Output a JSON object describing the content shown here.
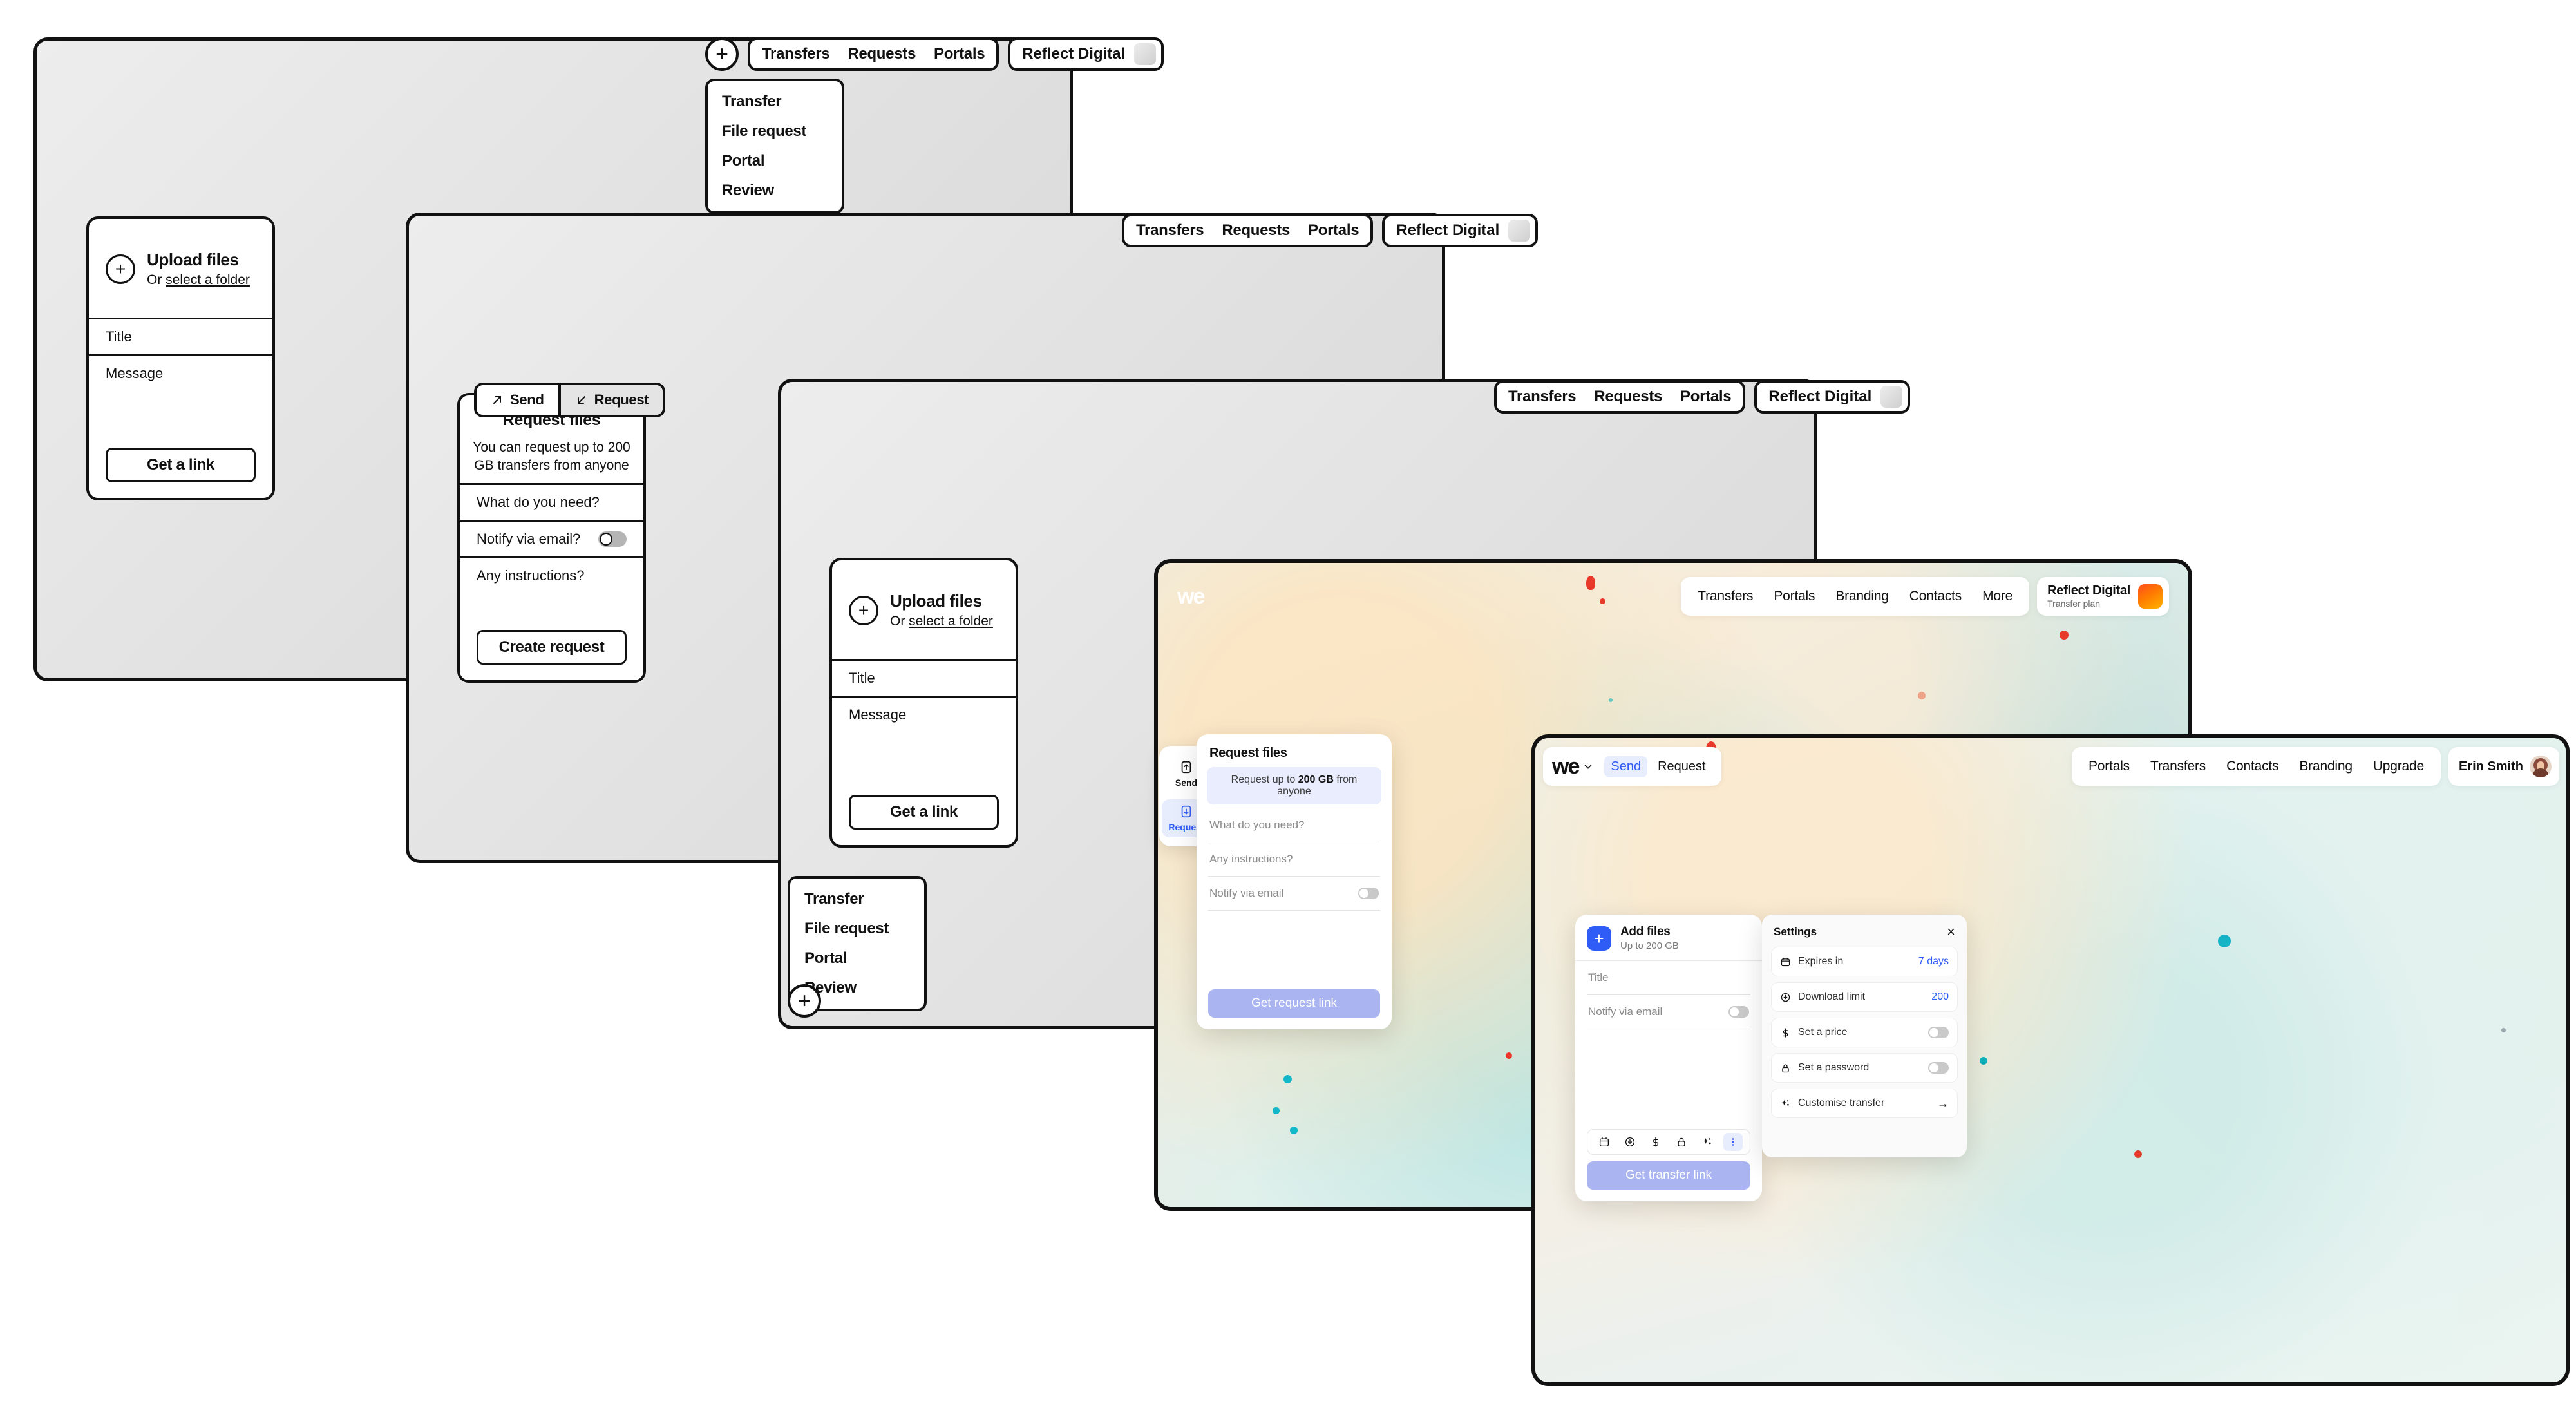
{
  "wireframes": {
    "nav": {
      "links": [
        "Transfers",
        "Requests",
        "Portals"
      ],
      "brand": "Reflect Digital",
      "plus": "+"
    },
    "menu": {
      "items": [
        "Transfer",
        "File request",
        "Portal",
        "Review"
      ]
    },
    "upload_card": {
      "title": "Upload files",
      "sub_prefix": "Or ",
      "sub_link": "select a folder",
      "plus": "+",
      "title_field": "Title",
      "message_field": "Message",
      "cta": "Get a link"
    },
    "request_card": {
      "tab_send": "Send",
      "tab_request": "Request",
      "heading": "Request files",
      "blurb": "You can request up to 200 GB transfers from anyone",
      "field_need": "What do you need?",
      "field_notify": "Notify via email?",
      "field_instructions": "Any instructions?",
      "cta": "Create request"
    }
  },
  "app_request_window": {
    "logo": "we",
    "nav": [
      "Transfers",
      "Portals",
      "Branding",
      "Contacts",
      "More"
    ],
    "brand_name": "Reflect Digital",
    "brand_plan": "Transfer plan",
    "rail": [
      {
        "label": "Send",
        "icon": "upload-file-icon",
        "active": false
      },
      {
        "label": "Request",
        "icon": "download-file-icon",
        "active": true
      }
    ],
    "panel": {
      "title": "Request files",
      "banner_pre": "Request up to ",
      "banner_bold": "200 GB",
      "banner_post": " from anyone",
      "field_need": "What do you need?",
      "field_instructions": "Any instructions?",
      "field_notify": "Notify via email",
      "cta": "Get request link"
    }
  },
  "app_transfer_window": {
    "logo": "we",
    "tabs": [
      {
        "label": "Send",
        "active": true
      },
      {
        "label": "Request",
        "active": false
      }
    ],
    "nav": [
      "Portals",
      "Transfers",
      "Contacts",
      "Branding",
      "Upgrade"
    ],
    "user_name": "Erin Smith",
    "add_files": {
      "plus": "+",
      "title": "Add files",
      "subtitle": "Up to 200 GB",
      "title_field": "Title",
      "notify_field": "Notify via email",
      "cta": "Get transfer link",
      "tools": [
        "calendar-icon",
        "download-icon",
        "dollar-icon",
        "lock-icon",
        "sparkle-icon",
        "more-vertical-icon"
      ]
    },
    "settings": {
      "title": "Settings",
      "close": "×",
      "rows": [
        {
          "icon": "calendar-icon",
          "label": "Expires in",
          "value": "7 days",
          "type": "value"
        },
        {
          "icon": "download-icon",
          "label": "Download limit",
          "value": "200",
          "type": "value"
        },
        {
          "icon": "dollar-icon",
          "label": "Set a price",
          "value": "",
          "type": "toggle"
        },
        {
          "icon": "lock-icon",
          "label": "Set a password",
          "value": "",
          "type": "toggle"
        },
        {
          "icon": "sparkle-icon",
          "label": "Customise transfer",
          "value": "→",
          "type": "arrow"
        }
      ]
    }
  },
  "colors": {
    "accent_blue": "#2f5cf6",
    "cta_lavender": "#aab4f0",
    "banner_blue": "#e9edfd",
    "brand_orange": "#ff7a00"
  }
}
